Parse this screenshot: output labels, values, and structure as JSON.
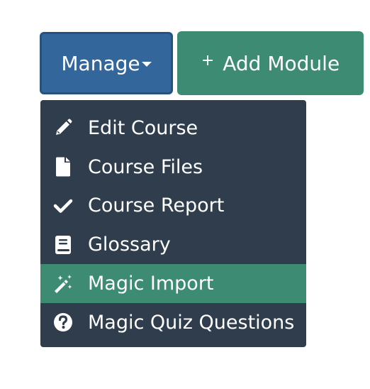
{
  "toolbar": {
    "manage_label": "Manage",
    "add_module_label": "Add Module",
    "add_module_icon": "plus-icon"
  },
  "menu": {
    "items": [
      {
        "label": "Edit Course",
        "icon": "pencil-icon",
        "active": false
      },
      {
        "label": "Course Files",
        "icon": "file-icon",
        "active": false
      },
      {
        "label": "Course Report",
        "icon": "checkmark-icon",
        "active": false
      },
      {
        "label": "Glossary",
        "icon": "book-icon",
        "active": false
      },
      {
        "label": "Magic Import",
        "icon": "magic-wand-icon",
        "active": true
      },
      {
        "label": "Magic Quiz Questions",
        "icon": "question-circle-icon",
        "active": false
      }
    ]
  },
  "colors": {
    "manage_bg": "#33669b",
    "add_module_bg": "#3d8b73",
    "menu_bg": "#2f3d4d",
    "active_item_bg": "#3d8b73",
    "text": "#ffffff"
  }
}
